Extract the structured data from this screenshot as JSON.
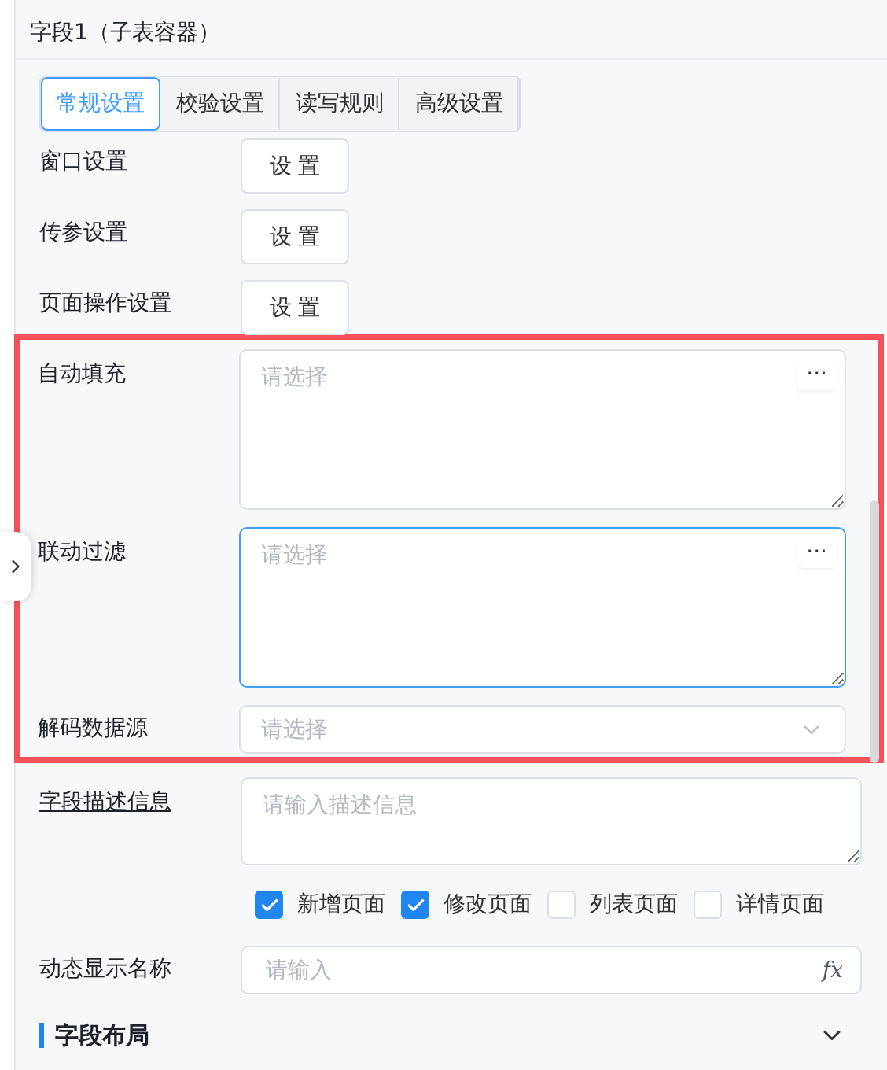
{
  "panel": {
    "title": "字段1（子表容器）"
  },
  "tabs": [
    {
      "label": "常规设置",
      "selected": true
    },
    {
      "label": "校验设置",
      "selected": false
    },
    {
      "label": "读写规则",
      "selected": false
    },
    {
      "label": "高级设置",
      "selected": false
    }
  ],
  "rows": [
    {
      "label": "窗口设置",
      "button": "设 置"
    },
    {
      "label": "传参设置",
      "button": "设 置"
    },
    {
      "label": "页面操作设置",
      "button": "设 置"
    }
  ],
  "highlighted_rows": [
    {
      "kind": "picker",
      "label": "自动填充",
      "placeholder": "请选择",
      "action": "···",
      "focused": false
    },
    {
      "kind": "picker",
      "label": "联动过滤",
      "placeholder": "请选择",
      "action": "···",
      "focused": true
    },
    {
      "kind": "select",
      "label": "解码数据源",
      "placeholder": "请选择"
    }
  ],
  "description": {
    "label": "字段描述信息",
    "placeholder": "请输入描述信息"
  },
  "pages": [
    {
      "label": "新增页面",
      "checked": true
    },
    {
      "label": "修改页面",
      "checked": true
    },
    {
      "label": "列表页面",
      "checked": false
    },
    {
      "label": "详情页面",
      "checked": false
    }
  ],
  "dynamic_name": {
    "label": "动态显示名称",
    "placeholder": "请输入",
    "suffix": "fx"
  },
  "section": {
    "title": "字段布局"
  }
}
